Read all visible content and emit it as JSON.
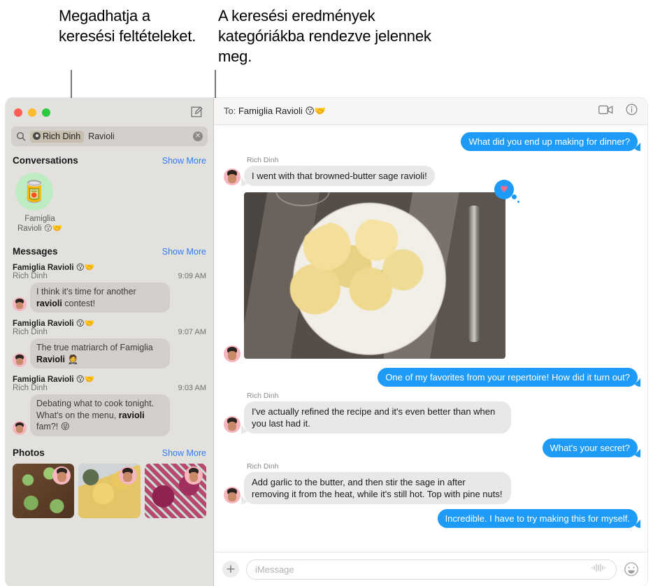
{
  "callouts": {
    "left": "Megadhatja a keresési feltételeket.",
    "right": "A keresési eredmények kategóriákba rendezve jelennek meg."
  },
  "window": {
    "traffic_lights": [
      "close",
      "minimize",
      "zoom"
    ],
    "compose_icon": "compose-icon"
  },
  "sidebar": {
    "search": {
      "glass_icon": "search-icon",
      "token_label": "Rich Dinh",
      "token_avatar_icon": "contact-avatar-icon",
      "query_text": "Ravioli",
      "clear_icon": "clear-icon",
      "clear_glyph": "✕"
    },
    "sections": [
      {
        "title": "Conversations",
        "more": "Show More"
      },
      {
        "title": "Messages",
        "more": "Show More"
      },
      {
        "title": "Photos",
        "more": "Show More"
      }
    ],
    "conversations": [
      {
        "avatar_emoji": "🥫",
        "avatar_bg": "#bdebc2",
        "name_line1": "Famiglia",
        "name_line2": "Ravioli 😗🤝"
      }
    ],
    "messages": [
      {
        "chat": "Famiglia Ravioli 😗🤝",
        "sender": "Rich Dinh",
        "time": "9:09 AM",
        "text_pre": "I think it's time for another ",
        "text_match": "ravioli",
        "text_post": " contest!"
      },
      {
        "chat": "Famiglia Ravioli 😗🤝",
        "sender": "Rich Dinh",
        "time": "9:07 AM",
        "text_pre": "The true matriarch of Famiglia ",
        "text_match": "Ravioli",
        "text_post": " 🤵"
      },
      {
        "chat": "Famiglia Ravioli 😗🤝",
        "sender": "Rich Dinh",
        "time": "9:03 AM",
        "text_pre": "Debating what to cook tonight. What's on the menu, ",
        "text_match": "ravioli",
        "text_post": " fam?! 😝"
      }
    ],
    "photos": [
      {
        "alt": "green-spinach-ravioli-photo"
      },
      {
        "alt": "browned-butter-sage-ravioli-photo"
      },
      {
        "alt": "beet-ravioli-photo"
      }
    ]
  },
  "conversation": {
    "to_label": "To:",
    "to_value": "Famiglia Ravioli 😗🤝",
    "facetime_icon": "video-camera-icon",
    "info_icon": "info-icon",
    "messages": [
      {
        "side": "out",
        "text": "What did you end up making for dinner?"
      },
      {
        "side": "in",
        "sender": "Rich Dinh",
        "text": "I went with that browned-butter sage ravioli!"
      },
      {
        "side": "in",
        "type": "photo",
        "sender": "",
        "alt": "ravioli-plate-photo",
        "reaction": "♥",
        "reaction_name": "heart-reaction"
      },
      {
        "side": "out",
        "text": "One of my favorites from your repertoire! How did it turn out?"
      },
      {
        "side": "in",
        "sender": "Rich Dinh",
        "text": "I've actually refined the recipe and it's even better than when you last had it."
      },
      {
        "side": "out",
        "text": "What's your secret?"
      },
      {
        "side": "in",
        "sender": "Rich Dinh",
        "text": "Add garlic to the butter, and then stir the sage in after removing it from the heat, while it's still hot. Top with pine nuts!"
      },
      {
        "side": "out",
        "text": "Incredible. I have to try making this for myself."
      }
    ],
    "composer": {
      "plus_icon": "add-attachment-icon",
      "plus_glyph": "+",
      "placeholder": "iMessage",
      "audio_icon": "audio-waveform-icon",
      "emoji_icon": "emoji-picker-icon"
    }
  },
  "colors": {
    "accent_blue": "#1d9bf6",
    "link_blue": "#2f7cf6",
    "sidebar_bg": "#e3e1de",
    "bubble_grey": "#e8e8e8"
  }
}
